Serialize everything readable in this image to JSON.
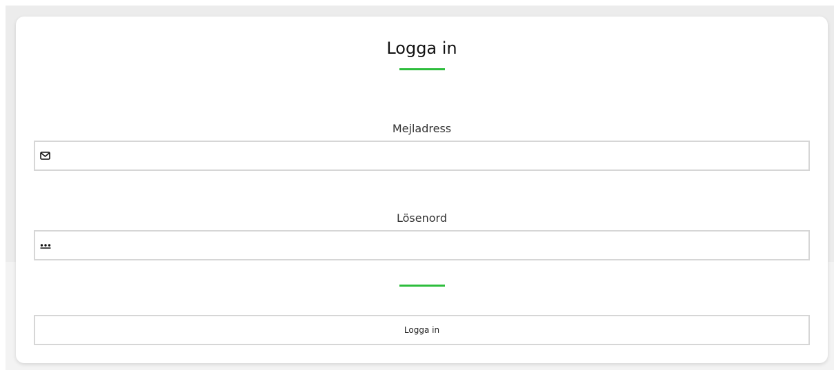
{
  "login": {
    "title": "Logga in",
    "email": {
      "label": "Mejladress",
      "value": "",
      "placeholder": "",
      "icon": "envelope-icon"
    },
    "password": {
      "label": "Lösenord",
      "value": "",
      "placeholder": "",
      "icon": "password-dots-icon"
    },
    "submit_label": "Logga in"
  },
  "colors": {
    "accent": "#2dbd3c",
    "border": "#d6d6d6",
    "backdrop": "#ececec"
  }
}
